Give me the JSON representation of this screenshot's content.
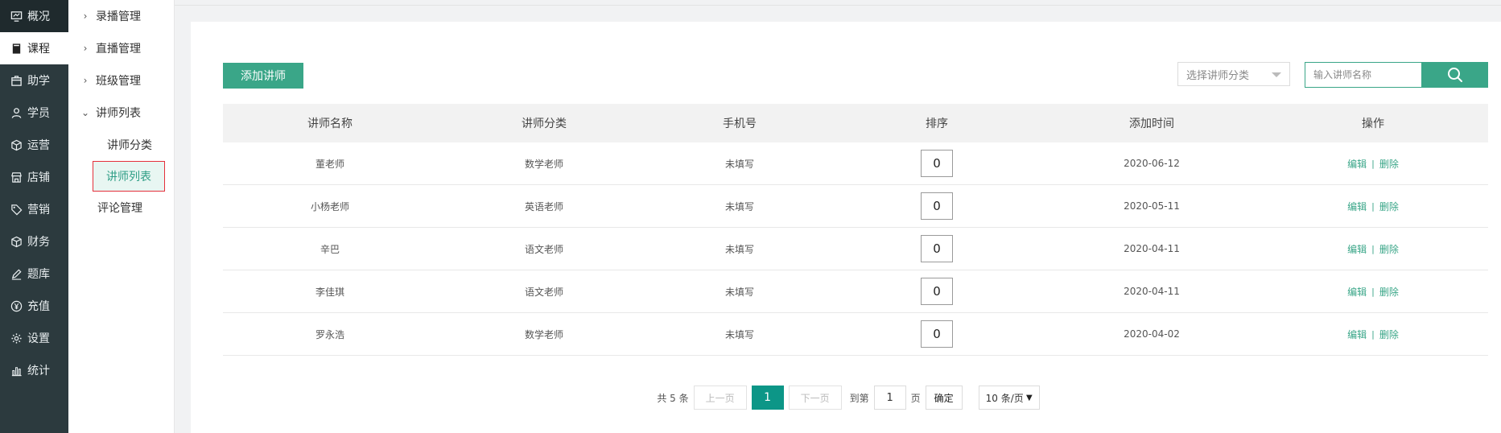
{
  "nav": {
    "items": [
      {
        "label": "概况",
        "icon": "monitor-icon"
      },
      {
        "label": "课程",
        "icon": "book-icon"
      },
      {
        "label": "助学",
        "icon": "box-icon"
      },
      {
        "label": "学员",
        "icon": "user-icon"
      },
      {
        "label": "运营",
        "icon": "cube-icon"
      },
      {
        "label": "店铺",
        "icon": "store-icon"
      },
      {
        "label": "营销",
        "icon": "tag-icon"
      },
      {
        "label": "财务",
        "icon": "cube-icon"
      },
      {
        "label": "题库",
        "icon": "pencil-icon"
      },
      {
        "label": "充值",
        "icon": "yen-icon"
      },
      {
        "label": "设置",
        "icon": "gear-icon"
      },
      {
        "label": "统计",
        "icon": "bar-chart-icon"
      }
    ],
    "active_index": 1
  },
  "subnav": {
    "groups": [
      {
        "label": "录播管理",
        "expanded": false
      },
      {
        "label": "直播管理",
        "expanded": false
      },
      {
        "label": "班级管理",
        "expanded": false
      },
      {
        "label": "讲师列表",
        "expanded": true
      }
    ],
    "children": [
      "讲师分类",
      "讲师列表"
    ],
    "active_child": "讲师列表",
    "extra": "评论管理"
  },
  "toolbar": {
    "add_label": "添加讲师",
    "category_placeholder": "选择讲师分类",
    "search_placeholder": "输入讲师名称"
  },
  "table": {
    "headers": [
      "讲师名称",
      "讲师分类",
      "手机号",
      "排序",
      "添加时间",
      "操作"
    ],
    "rows": [
      {
        "name": "董老师",
        "category": "数学老师",
        "phone": "未填写",
        "rank": "0",
        "date": "2020-06-12"
      },
      {
        "name": "小杨老师",
        "category": "英语老师",
        "phone": "未填写",
        "rank": "0",
        "date": "2020-05-11"
      },
      {
        "name": "辛巴",
        "category": "语文老师",
        "phone": "未填写",
        "rank": "0",
        "date": "2020-04-11"
      },
      {
        "name": "李佳琪",
        "category": "语文老师",
        "phone": "未填写",
        "rank": "0",
        "date": "2020-04-11"
      },
      {
        "name": "罗永浩",
        "category": "数学老师",
        "phone": "未填写",
        "rank": "0",
        "date": "2020-04-02"
      }
    ],
    "edit_label": "编辑",
    "delete_label": "删除"
  },
  "pager": {
    "total": "共 5 条",
    "prev": "上一页",
    "current": "1",
    "next": "下一页",
    "goto": "到第",
    "goto_value": "1",
    "page_unit": "页",
    "ok": "确定",
    "size": "10 条/页"
  },
  "colors": {
    "accent": "#3aa688",
    "nav_bg": "#2c3a3e",
    "current_page": "#0c9687",
    "highlight_border": "#e5303b"
  }
}
